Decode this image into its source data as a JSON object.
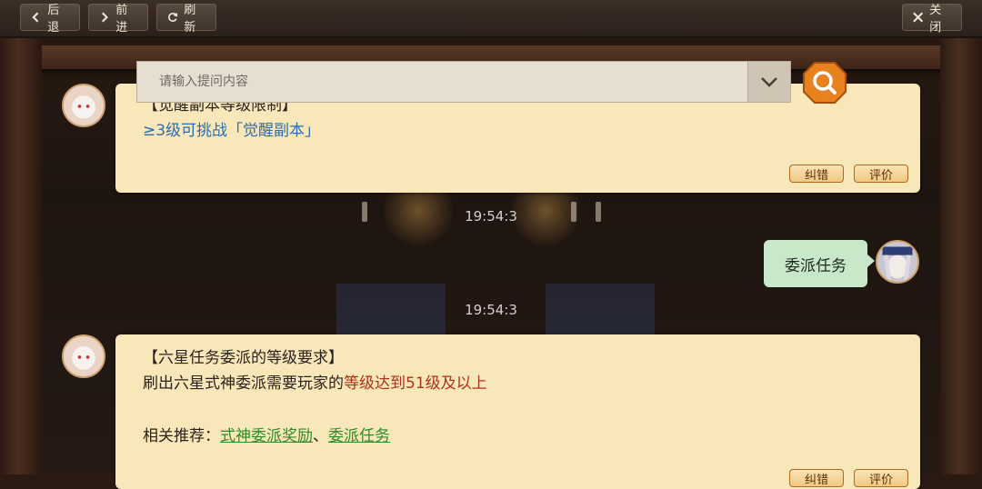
{
  "toolbar": {
    "back_label": "后退",
    "forward_label": "前进",
    "refresh_label": "刷新",
    "close_label": "关闭"
  },
  "search": {
    "placeholder": "请输入提问内容",
    "value": ""
  },
  "messages": {
    "first": {
      "title_partial": "【觉醒副本等级限制】",
      "line": "≥3级可挑战「觉醒副本」",
      "report_label": "纠错",
      "rate_label": "评价"
    },
    "timestamp_1": "19:54:3",
    "user_query": "委派任务",
    "timestamp_2": "19:54:3",
    "second": {
      "title": "【六星任务委派的等级要求】",
      "line_prefix": "刷出六星式神委派需要玩家的",
      "line_highlight": "等级达到51级及以上",
      "related_prefix": "相关推荐：",
      "related_link_1": "式神委派奖励",
      "related_sep": "、",
      "related_link_2": "委派任务",
      "report_label": "纠错",
      "rate_label": "评价"
    }
  },
  "colors": {
    "bubble_bg": "#f8e7b8",
    "user_bubble_bg": "#c9e7c9",
    "highlight_red": "#b0311c",
    "link_green": "#2f8a2a",
    "blue_text": "#2d6eb0",
    "search_button": "#e8821f"
  },
  "icons": {
    "back": "chevron-left-icon",
    "forward": "chevron-right-icon",
    "refresh": "refresh-icon",
    "close": "close-icon",
    "dropdown": "chevron-down-icon",
    "search": "search-icon"
  }
}
